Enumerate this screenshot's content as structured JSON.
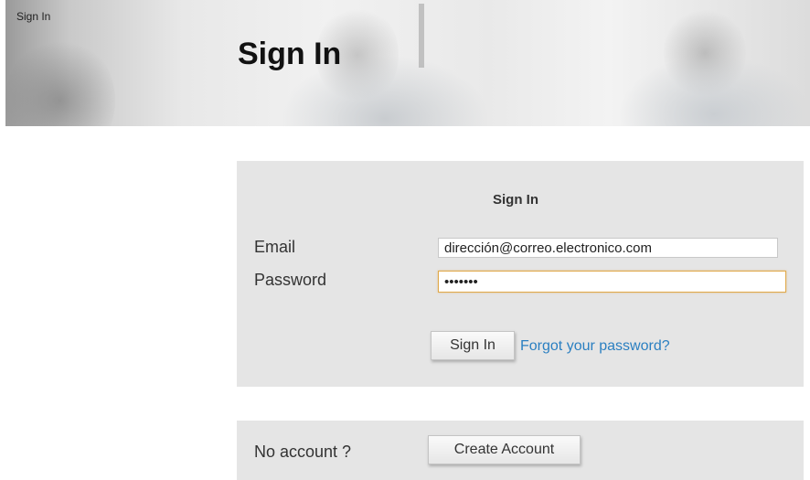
{
  "breadcrumb": {
    "label": "Sign In"
  },
  "header": {
    "title": "Sign In"
  },
  "signin_form": {
    "heading": "Sign In",
    "email_label": "Email",
    "email_value": "dirección@correo.electronico.com",
    "password_label": "Password",
    "password_value": "•••••••",
    "submit_label": "Sign In",
    "forgot_label": "Forgot your password?"
  },
  "account": {
    "prompt": "No account ?",
    "create_label": "Create Account"
  },
  "colors": {
    "panel_bg": "#e5e5e5",
    "link": "#2a7fc1",
    "focus_border": "#e0a94a"
  }
}
